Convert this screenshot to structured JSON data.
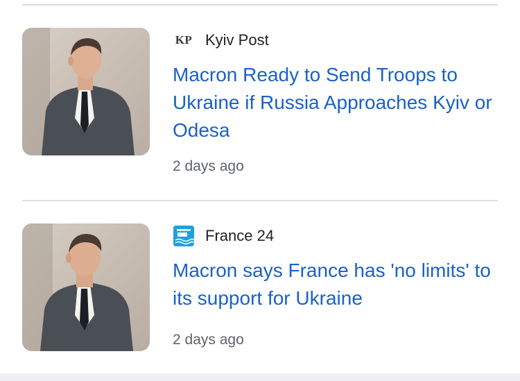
{
  "articles": [
    {
      "source": {
        "name": "Kyiv Post",
        "logo_text": "KP",
        "logo_icon": "kyiv-post-logo"
      },
      "headline": "Macron Ready to Send Troops to Ukraine if Russia Approaches Kyiv or Odesa",
      "time": "2 days ago",
      "thumbnail_icon": "macron-photo"
    },
    {
      "source": {
        "name": "France 24",
        "logo_text": "FRANCE 24",
        "logo_icon": "france-24-logo"
      },
      "headline": "Macron says France has 'no limits' to its support for Ukraine",
      "time": "2 days ago",
      "thumbnail_icon": "macron-photo"
    }
  ],
  "colors": {
    "headline": "#1a61c7",
    "source_text": "#202124",
    "time_text": "#5f6368",
    "divider": "#dcdcdc",
    "france24_logo": "#1fa0dc"
  }
}
